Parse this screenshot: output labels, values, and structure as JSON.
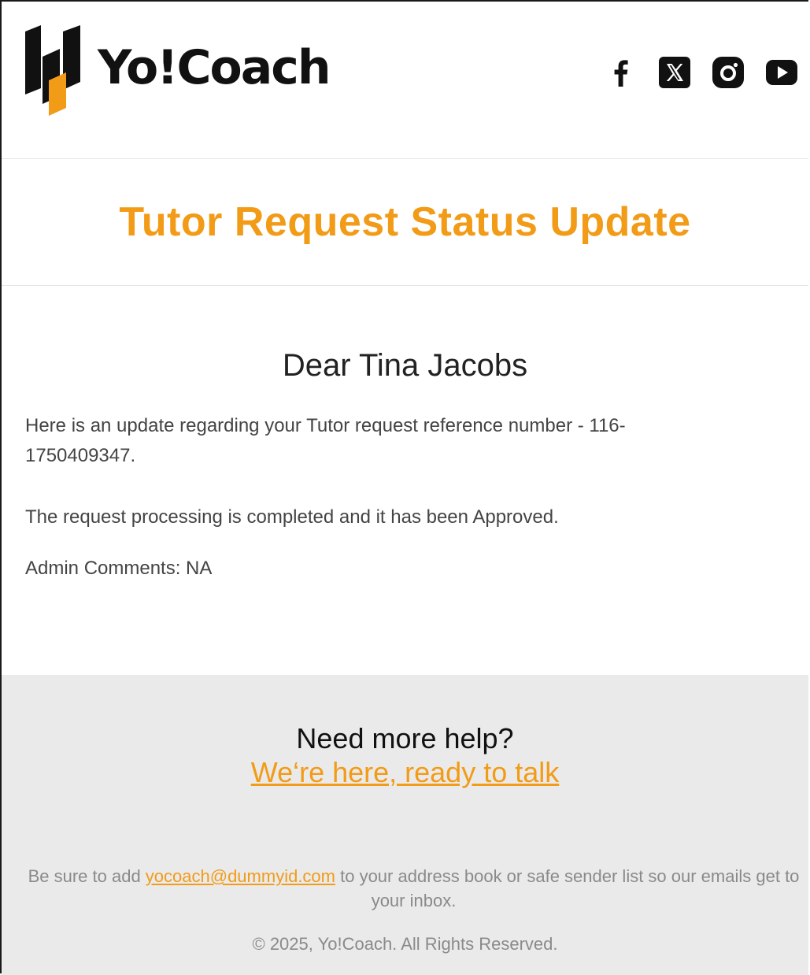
{
  "brand": {
    "name": "Yo!Coach",
    "accent_color": "#f29b17",
    "logo_icon": "yocoach-logo-mark"
  },
  "social": [
    {
      "name": "facebook-icon"
    },
    {
      "name": "x-icon"
    },
    {
      "name": "instagram-icon"
    },
    {
      "name": "youtube-icon"
    }
  ],
  "email": {
    "title": "Tutor Request Status Update",
    "greeting": "Dear Tina Jacobs",
    "paragraph_1": "Here is an update regarding your Tutor request reference number - 116-1750409347.",
    "paragraph_2": "The request processing is completed and it has been Approved.",
    "paragraph_3": "Admin Comments: NA"
  },
  "footer": {
    "help_title": "Need more help?",
    "help_link": "We‘re here, ready to talk",
    "notice_before": "Be sure to add ",
    "notice_email": "yocoach@dummyid.com",
    "notice_after": " to your address book or safe sender list so our emails get to your inbox.",
    "copyright": "© 2025, Yo!Coach. All Rights Reserved."
  }
}
